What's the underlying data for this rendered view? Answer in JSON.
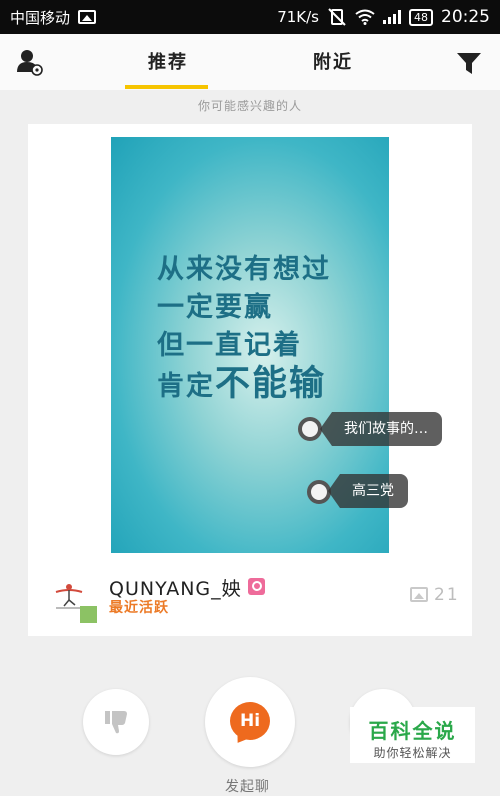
{
  "status_bar": {
    "carrier": "中国移动",
    "net_speed": "71K/s",
    "battery": "48",
    "time": "20:25"
  },
  "nav": {
    "tabs": [
      {
        "label": "推荐",
        "active": true
      },
      {
        "label": "附近",
        "active": false
      }
    ],
    "accent_color": "#f6c400"
  },
  "subtitle": "你可能感兴趣的人",
  "card": {
    "photo_text": {
      "line1": "从来没有想过",
      "line2": "一定要赢",
      "line3": "但一直记着",
      "line4_a": "肯定",
      "line4_b": "不能输"
    },
    "tags": [
      "我们故事的…",
      "高三党"
    ],
    "user": {
      "name": "QUNYANG_姎",
      "status": "最近活跃",
      "photo_count": "21"
    }
  },
  "actions": {
    "hi_label": "Hi",
    "start_chat": "发起聊"
  },
  "watermark": {
    "title": "百科全说",
    "subtitle": "助你轻松解决"
  }
}
